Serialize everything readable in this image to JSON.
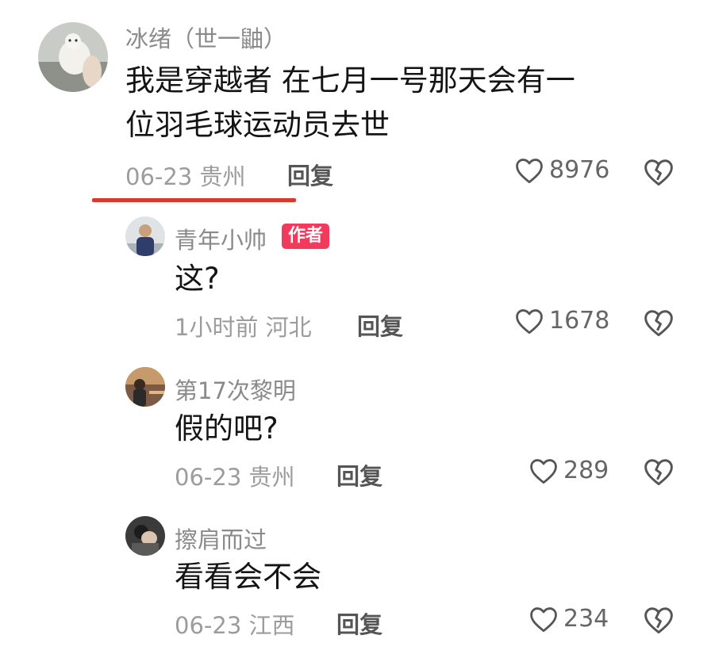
{
  "comments": [
    {
      "username": "冰绪（世一鼬）",
      "lines": [
        "我是穿越者 在七月一号那天会有一",
        "位羽毛球运动员去世"
      ],
      "date_location": "06-23 贵州",
      "reply_label": "回复",
      "likes": "8976"
    }
  ],
  "replies": [
    {
      "username": "青年小帅",
      "badge": "作者",
      "text": "这?",
      "date_location": "1小时前 河北",
      "reply_label": "回复",
      "likes": "1678"
    },
    {
      "username": "第17次黎明",
      "text": "假的吧?",
      "date_location": "06-23 贵州",
      "reply_label": "回复",
      "likes": "289"
    },
    {
      "username": "擦肩而过",
      "text": "看看会不会",
      "date_location": "06-23 江西",
      "reply_label": "回复",
      "likes": "234"
    }
  ],
  "icons": {
    "like": "heart-outline-icon",
    "dislike": "broken-heart-icon"
  },
  "colors": {
    "accent_underline": "#e0362a",
    "author_badge": "#f23a5c",
    "muted_text": "#9c9c9c"
  }
}
